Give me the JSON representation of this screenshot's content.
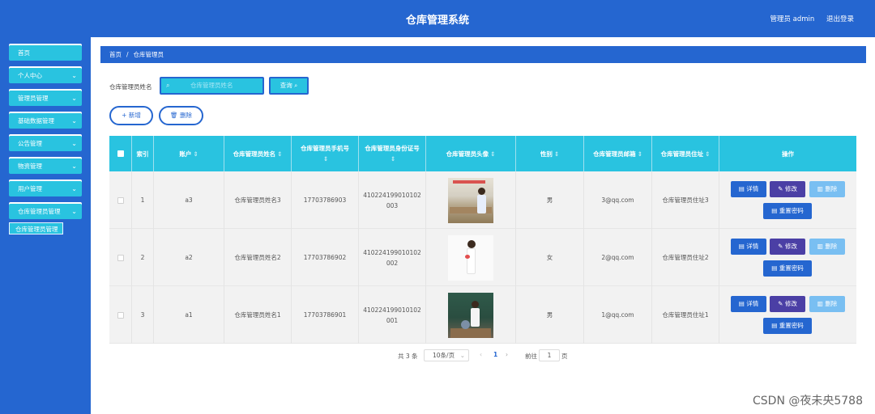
{
  "header": {
    "title": "仓库管理系统",
    "user_label": "管理员 admin",
    "logout_label": "退出登录"
  },
  "sidebar": {
    "items": [
      {
        "label": "首页",
        "has_chevron": false
      },
      {
        "label": "个人中心",
        "has_chevron": true
      },
      {
        "label": "管理员管理",
        "has_chevron": true
      },
      {
        "label": "基础数据管理",
        "has_chevron": true
      },
      {
        "label": "公告管理",
        "has_chevron": true
      },
      {
        "label": "物资管理",
        "has_chevron": true
      },
      {
        "label": "用户管理",
        "has_chevron": true
      },
      {
        "label": "仓库管理员管理",
        "has_chevron": true
      }
    ],
    "active_sub_item": "仓库管理员管理",
    "chevron": "⌄"
  },
  "breadcrumb": {
    "home": "首页",
    "separator": "/",
    "current": "仓库管理员"
  },
  "search": {
    "label": "仓库管理员姓名",
    "placeholder": "仓库管理员姓名",
    "button_label": "查询"
  },
  "actions": {
    "add_label": "新增",
    "delete_label": "删除"
  },
  "table": {
    "columns": [
      "索引",
      "账户",
      "仓库管理员姓名",
      "仓库管理员手机号",
      "仓库管理员身份证号",
      "仓库管理员头像",
      "性别",
      "仓库管理员邮箱",
      "仓库管理员住址",
      "操作"
    ],
    "sort_icon": "⇕",
    "rows": [
      {
        "index": "1",
        "account": "a3",
        "name": "仓库管理员姓名3",
        "phone": "17703786903",
        "id_line1": "410224199010102",
        "id_line2": "003",
        "gender": "男",
        "email": "3@qq.com",
        "address": "仓库管理员住址3",
        "photo": "classroom"
      },
      {
        "index": "2",
        "account": "a2",
        "name": "仓库管理员姓名2",
        "phone": "17703786902",
        "id_line1": "410224199010102",
        "id_line2": "002",
        "gender": "女",
        "email": "2@qq.com",
        "address": "仓库管理员住址2",
        "photo": "white"
      },
      {
        "index": "3",
        "account": "a1",
        "name": "仓库管理员姓名1",
        "phone": "17703786901",
        "id_line1": "410224199010102",
        "id_line2": "001",
        "gender": "男",
        "email": "1@qq.com",
        "address": "仓库管理员住址1",
        "photo": "board"
      }
    ],
    "row_actions": {
      "detail": "详情",
      "edit": "修改",
      "delete": "删除",
      "reset": "重置密码"
    }
  },
  "pagination": {
    "total": "共 3 条",
    "page_size": "10条/页",
    "prev": "‹",
    "current_page": "1",
    "next": "›",
    "goto_label": "前往",
    "goto_value": "1",
    "page_unit": "页"
  },
  "watermark": "CSDN @夜未央5788",
  "colors": {
    "primary": "#2566d0",
    "accent": "#29c3e0",
    "edit": "#4b3fa5",
    "delete_light": "#79bff2"
  }
}
